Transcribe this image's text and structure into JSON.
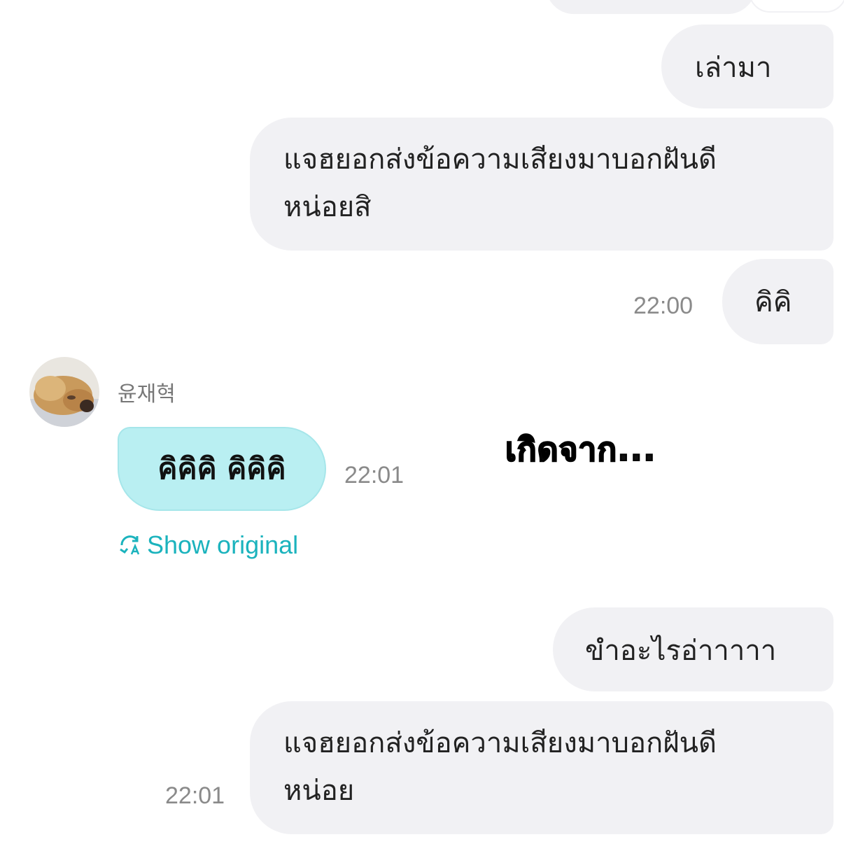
{
  "messages": {
    "m1": {
      "text": "เล่ามา"
    },
    "m2": {
      "line1": "แจฮยอกส่งข้อความเสียงมาบอกฝันดี",
      "line2": "หน่อยสิ"
    },
    "m3": {
      "text": "คิคิ",
      "time": "22:00"
    },
    "incoming": {
      "sender": "윤재혁",
      "text": "คิคิคิ คิคิคิ",
      "time": "22:01",
      "show_original": "Show original"
    },
    "m4": {
      "text": "ขำอะไรอ่าาาาา"
    },
    "m5": {
      "line1": "แจฮยอกส่งข้อความเสียงมาบอกฝันดี",
      "line2": "หน่อย",
      "time": "22:01"
    }
  },
  "overlay_caption": "เกิดจาก...",
  "colors": {
    "outgoing_bubble": "#f1f1f4",
    "incoming_bubble": "#b9eff2",
    "accent": "#1bb3bd",
    "timestamp": "#8a8a8a"
  },
  "icons": {
    "translate": "translate-icon",
    "avatar": "avatar-dog-photo"
  }
}
